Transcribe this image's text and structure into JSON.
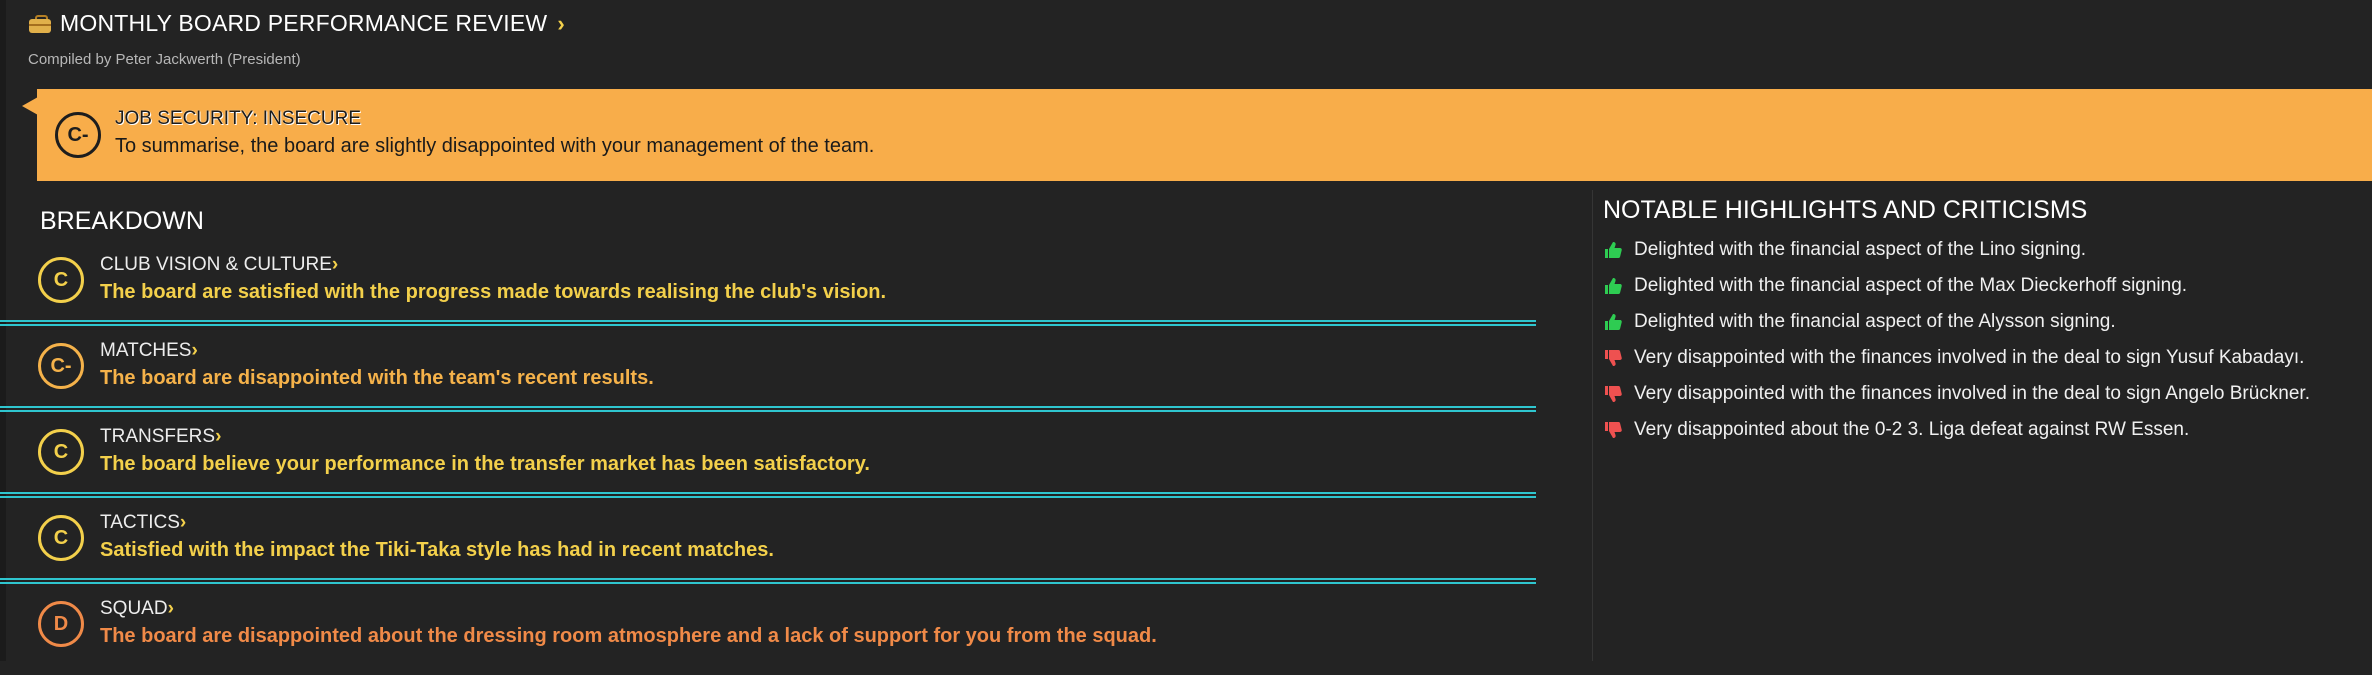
{
  "header": {
    "title": "MONTHLY BOARD PERFORMANCE REVIEW",
    "subtitle": "Compiled by Peter Jackwerth (President)"
  },
  "job_security": {
    "grade": "C-",
    "heading": "JOB SECURITY: INSECURE",
    "summary": "To summarise, the board are slightly disappointed with your management of the team.",
    "color": "#f8ad4a"
  },
  "breakdown": {
    "title": "BREAKDOWN",
    "items": [
      {
        "grade": "C",
        "label": "CLUB VISION & CULTURE",
        "text": "The board are satisfied with the progress made towards realising the club's vision.",
        "color": "#f3d04b"
      },
      {
        "grade": "C-",
        "label": "MATCHES",
        "text": "The board are disappointed with the team's recent results.",
        "color": "#f5b24a"
      },
      {
        "grade": "C",
        "label": "TRANSFERS",
        "text": "The board believe your performance in the transfer market has been satisfactory.",
        "color": "#f3d04b"
      },
      {
        "grade": "C",
        "label": "TACTICS",
        "text": "Satisfied with the impact the Tiki-Taka style has had in recent matches.",
        "color": "#f3d04b"
      },
      {
        "grade": "D",
        "label": "SQUAD",
        "text": "The board are disappointed about the dressing room atmosphere and a lack of support for you from the squad.",
        "color": "#f08a48"
      }
    ]
  },
  "highlights": {
    "title": "NOTABLE HIGHLIGHTS AND CRITICISMS",
    "items": [
      {
        "icon": "thumbs-up-icon",
        "text": "Delighted with the financial aspect of the Lino signing."
      },
      {
        "icon": "thumbs-up-icon",
        "text": "Delighted with the financial aspect of the Max Dieckerhoff signing."
      },
      {
        "icon": "thumbs-up-icon",
        "text": "Delighted with the financial aspect of the Alysson signing."
      },
      {
        "icon": "thumbs-down-icon",
        "text": "Very disappointed with the finances involved in the deal to sign Yusuf Kabadayı."
      },
      {
        "icon": "thumbs-down-icon",
        "text": "Very disappointed with the finances involved in the deal to sign Angelo Brückner."
      },
      {
        "icon": "thumbs-down-icon",
        "text": "Very disappointed about the 0-2 3. Liga defeat against RW Essen."
      }
    ]
  },
  "colors": {
    "positive": "#2ecc52",
    "negative": "#ee5150",
    "divider": "#2fc6cf",
    "chevron": "#f3d04b"
  }
}
